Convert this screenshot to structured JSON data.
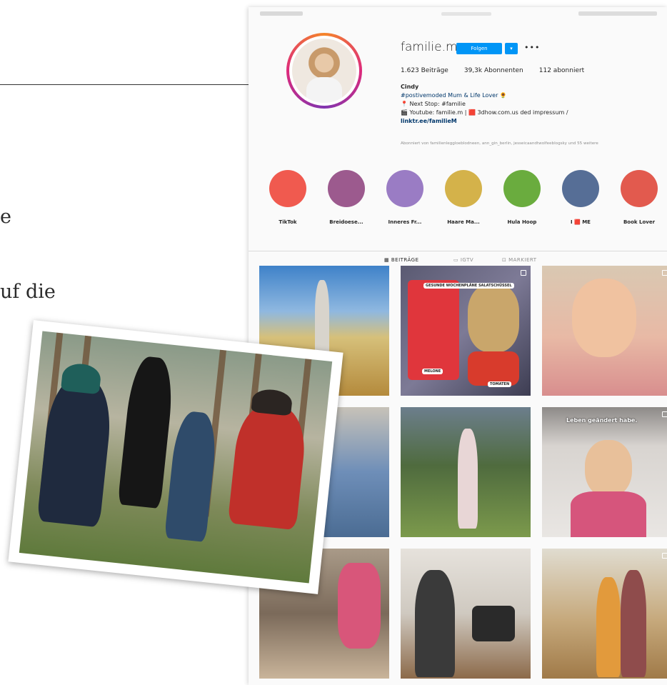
{
  "magazine": {
    "line1": "e",
    "line2": "uf die"
  },
  "profile": {
    "username": "familie.m",
    "follow_label": "Folgen",
    "more_label": "•••",
    "stats": {
      "posts": "1.623 Beiträge",
      "followers": "39,3k Abonnenten",
      "following": "112 abonniert"
    },
    "bio": {
      "name": "Cindy",
      "line1": "#postivemoded Mum & Life Lover 🌻",
      "line2": "📍 Next Stop: #familie",
      "line3": "🎬 Youtube: familie.m | 🟥 3dhow.com.us ded impressum /",
      "link": "linktr.ee/familieM"
    },
    "followed_by": "Abonniert von familienleggloeblodneen, ann_gin_berlin, jesseicaandtwolfeeblogsky und 55 weitere"
  },
  "highlights": [
    {
      "label": "TikTok",
      "color": "#f05a4f"
    },
    {
      "label": "Breidoese...",
      "color": "#9c5a8e"
    },
    {
      "label": "Inneres Fr...",
      "color": "#9a7cc4"
    },
    {
      "label": "Haare Ma...",
      "color": "#d4b24a"
    },
    {
      "label": "Hula Hoop",
      "color": "#6aac3e"
    },
    {
      "label": "I 🟥 ME",
      "color": "#566e96"
    },
    {
      "label": "Book Lover",
      "color": "#e25a4e"
    }
  ],
  "tabs": {
    "posts": "BEITRÄGE",
    "igtv": "IGTV",
    "tagged": "MARKIERT"
  },
  "grid": {
    "sticker_main": "GESUNDE WOCHENPLÄNE SALATSCHÜSSEL",
    "sticker_left": "MELONE",
    "sticker_right": "TOMATEN",
    "overlay_text": "Leben geändert habe."
  }
}
